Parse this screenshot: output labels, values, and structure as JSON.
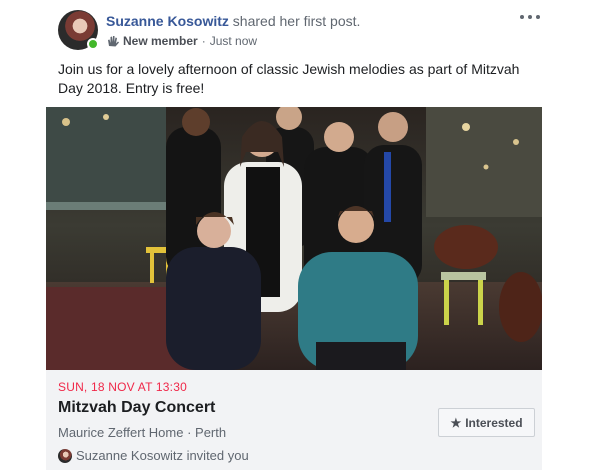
{
  "post": {
    "author": "Suzanne Kosowitz",
    "action": "shared her first post.",
    "badge": "New member",
    "separator": "·",
    "time": "Just now",
    "text": "Join us for a lovely afternoon of classic Jewish melodies as part of Mitzvah Day 2018. Entry is free!",
    "badge_icon": "wave-icon",
    "more_icon": "more-options-icon"
  },
  "event": {
    "date": "SUN, 18 NOV AT 13:30",
    "title": "Mitzvah Day Concert",
    "venue": "Maurice Zeffert Home · Perth",
    "invite": "Suzanne Kosowitz invited you",
    "interested_label": "Interested",
    "interested_icon": "star-icon"
  },
  "colors": {
    "author_link": "#385898",
    "date_red": "#f02849",
    "online_green": "#42b72a",
    "card_background": "#f2f3f5"
  }
}
